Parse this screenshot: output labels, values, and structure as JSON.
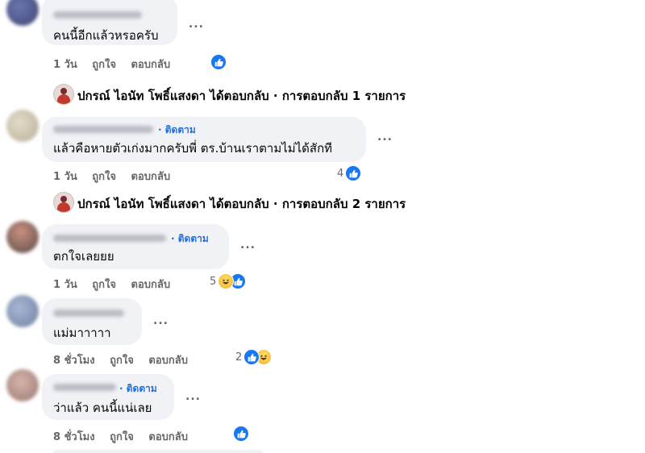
{
  "colors": {
    "bubble": "#f0f2f5",
    "link": "#216fdb",
    "meta": "#65676b",
    "like": "#1877f2"
  },
  "actions": {
    "like": "ถูกใจ",
    "reply": "ตอบกลับ"
  },
  "follow_label": "· ติดตาม",
  "follow_label_plain": "ติดตาม",
  "dots": "...",
  "comments": [
    {
      "text": "คนนี้อีกแล้วหรอครับ",
      "time": "1 วัน",
      "reactions": [
        "like"
      ],
      "reaction_count": ""
    },
    {
      "text": "แล้วคือหายตัวเก่งมากครับพี่ ตร.บ้านเราตามไม่ได้สักที",
      "time": "1 วัน",
      "reactions": [
        "like"
      ],
      "reaction_count": "4"
    },
    {
      "text": "ตกใจเลยยย",
      "time": "1 วัน",
      "reactions": [
        "haha",
        "like"
      ],
      "reaction_count": "5"
    },
    {
      "text": "แม่มาาาาา",
      "time": "8 ชั่วโมง",
      "reactions": [
        "like",
        "haha"
      ],
      "reaction_count": "2"
    },
    {
      "text": "ว่าแล้ว คนนี้แน่เลย",
      "time": "8 ชั่วโมง",
      "reactions": [
        "like"
      ],
      "reaction_count": ""
    }
  ],
  "replies": [
    {
      "text": "ปกรณ์ ไอนัท โพธิ์แสงดา ได้ตอบกลับ · การตอบกลับ 1 รายการ"
    },
    {
      "text": "ปกรณ์ ไอนัท โพธิ์แสงดา ได้ตอบกลับ · การตอบกลับ 2 รายการ"
    }
  ]
}
